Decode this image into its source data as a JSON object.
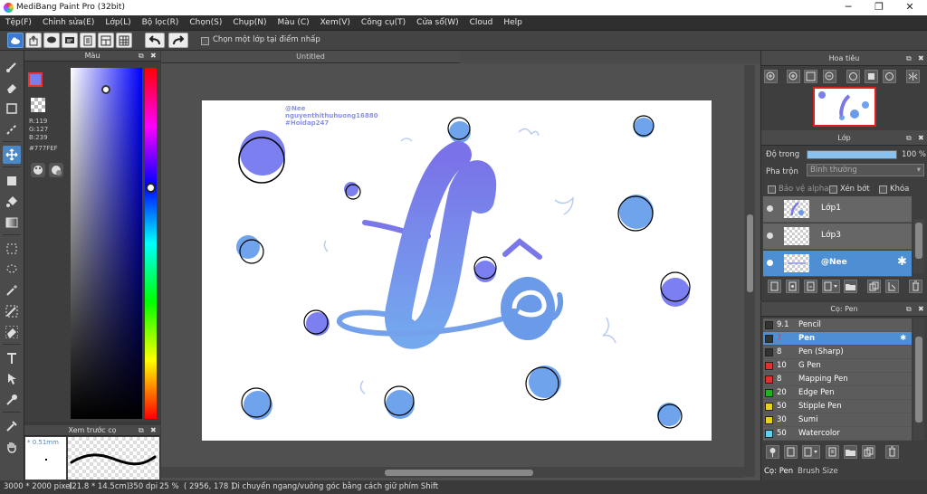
{
  "window": {
    "title": "MediBang Paint Pro (32bit)",
    "minimize": "─",
    "maximize": "❐",
    "close": "✕"
  },
  "menu": [
    "Tệp(F)",
    "Chỉnh sửa(E)",
    "Lớp(L)",
    "Bộ lọc(R)",
    "Chọn(S)",
    "Chụp(N)",
    "Màu (C)",
    "Xem(V)",
    "Công cụ(T)",
    "Cửa sổ(W)",
    "Cloud",
    "Help"
  ],
  "toolbar": {
    "select_layer_label": "Chọn một lớp tại điểm nhấp"
  },
  "color_panel": {
    "title": "Màu",
    "r": "R:119",
    "g": "G:127",
    "b": "B:239",
    "hex": "#777FEF",
    "primary_color": "#777FEF"
  },
  "preview_panel": {
    "title": "Xem trước cọ",
    "size": "* 0.51mm"
  },
  "canvas": {
    "tab": "Untitled",
    "watermark": {
      "line1": "@Nee",
      "line2": "nguyenthithuhuong16880",
      "line3": "#Hoidap247"
    }
  },
  "navigator": {
    "title": "Hoa tiêu"
  },
  "layers": {
    "title": "Lớp",
    "opacity_label": "Độ trong",
    "opacity_value": "100 %",
    "blend_label": "Pha trộn",
    "blend_value": "Bình thường",
    "protect_alpha": "Bảo vệ alpha",
    "clip": "Xén bớt",
    "lock": "Khóa",
    "items": [
      {
        "name": "Lớp1"
      },
      {
        "name": "Lớp3"
      },
      {
        "name": "@Nee"
      }
    ]
  },
  "brush_panel": {
    "title": "Cọ: Pen",
    "items": [
      {
        "size": "9.1",
        "name": "Pencil",
        "color": "#333333"
      },
      {
        "size": "7",
        "name": "Pen",
        "color": "#333333"
      },
      {
        "size": "8",
        "name": "Pen (Sharp)",
        "color": "#333333"
      },
      {
        "size": "10",
        "name": "G Pen",
        "color": "#e03030"
      },
      {
        "size": "8",
        "name": "Mapping Pen",
        "color": "#e03030"
      },
      {
        "size": "20",
        "name": "Edge Pen",
        "color": "#20b020"
      },
      {
        "size": "50",
        "name": "Stipple Pen",
        "color": "#e8d020"
      },
      {
        "size": "30",
        "name": "Sumi",
        "color": "#e8d020"
      },
      {
        "size": "50",
        "name": "Watercolor",
        "color": "#60d0f0"
      }
    ],
    "tab_brush": "Cọ: Pen",
    "tab_size": "Brush Size"
  },
  "status": {
    "dims": "3000 * 2000 pixel",
    "size_cm": "(21.8 * 14.5cm)",
    "dpi": "350 dpi",
    "zoom": "25 %",
    "coords": "( 2956, 178 )",
    "hint": "Di chuyển ngang/vuông góc bằng cách giữ phím Shift"
  }
}
